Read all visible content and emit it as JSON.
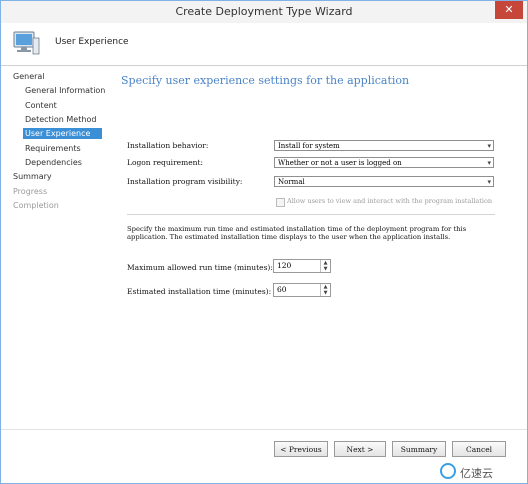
{
  "window": {
    "title": "Create Deployment Type Wizard",
    "close_glyph": "✕"
  },
  "header": {
    "icon": "computer-icon",
    "page_name": "User Experience"
  },
  "sidebar": {
    "items": [
      {
        "label": "General",
        "level": 0,
        "state": "normal"
      },
      {
        "label": "General Information",
        "level": 1,
        "state": "normal"
      },
      {
        "label": "Content",
        "level": 1,
        "state": "normal"
      },
      {
        "label": "Detection Method",
        "level": 1,
        "state": "normal"
      },
      {
        "label": "User Experience",
        "level": 1,
        "state": "active"
      },
      {
        "label": "Requirements",
        "level": 1,
        "state": "normal"
      },
      {
        "label": "Dependencies",
        "level": 1,
        "state": "normal"
      },
      {
        "label": "Summary",
        "level": 0,
        "state": "normal"
      },
      {
        "label": "Progress",
        "level": 0,
        "state": "disabled"
      },
      {
        "label": "Completion",
        "level": 0,
        "state": "disabled"
      }
    ]
  },
  "main": {
    "title": "Specify user experience settings for the application",
    "installation_behavior": {
      "label": "Installation behavior:",
      "value": "Install for system"
    },
    "logon_requirement": {
      "label": "Logon requirement:",
      "value": "Whether or not a user is logged on"
    },
    "program_visibility": {
      "label": "Installation program visibility:",
      "value": "Normal"
    },
    "allow_users_checkbox": {
      "label": "Allow users to view and interact with the program installation",
      "checked": false,
      "enabled": false
    },
    "description": "Specify the maximum run time and estimated installation time of the deployment program for this application. The estimated installation time displays to the user when the application installs.",
    "max_runtime": {
      "label": "Maximum allowed run time (minutes):",
      "value": "120"
    },
    "est_install_time": {
      "label": "Estimated installation time (minutes):",
      "value": "60"
    }
  },
  "buttons": {
    "previous": "< Previous",
    "next": "Next >",
    "summary": "Summary",
    "cancel": "Cancel"
  },
  "watermark": {
    "text": "亿速云",
    "icon": "cloud-logo-icon"
  }
}
